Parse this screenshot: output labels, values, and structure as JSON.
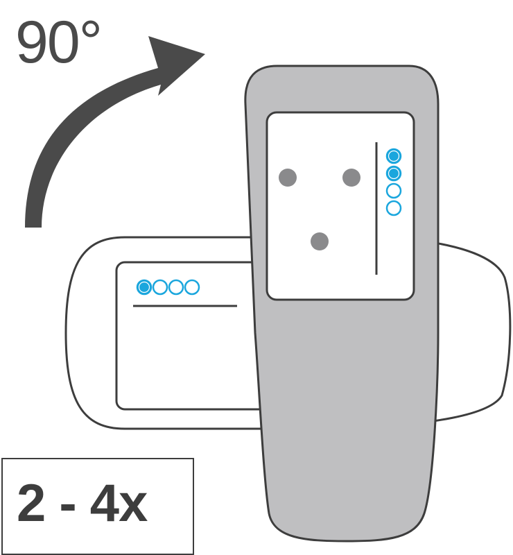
{
  "rotation": {
    "label": "90°"
  },
  "repeat": {
    "label": "2 - 4x"
  },
  "colors": {
    "device_body": "#bfbfc1",
    "outline": "#3d3d3d",
    "screen": "#ffffff",
    "arrow": "#4a4a4a",
    "marker_dot": "#8a8a8c",
    "indicator_on": "#1aa6dd",
    "indicator_off": "#ffffff"
  },
  "horizontal_device": {
    "indicators": [
      "on",
      "off",
      "off",
      "off"
    ]
  },
  "vertical_device": {
    "indicators": [
      "on",
      "on",
      "off",
      "off"
    ],
    "marker_dots": 3
  }
}
